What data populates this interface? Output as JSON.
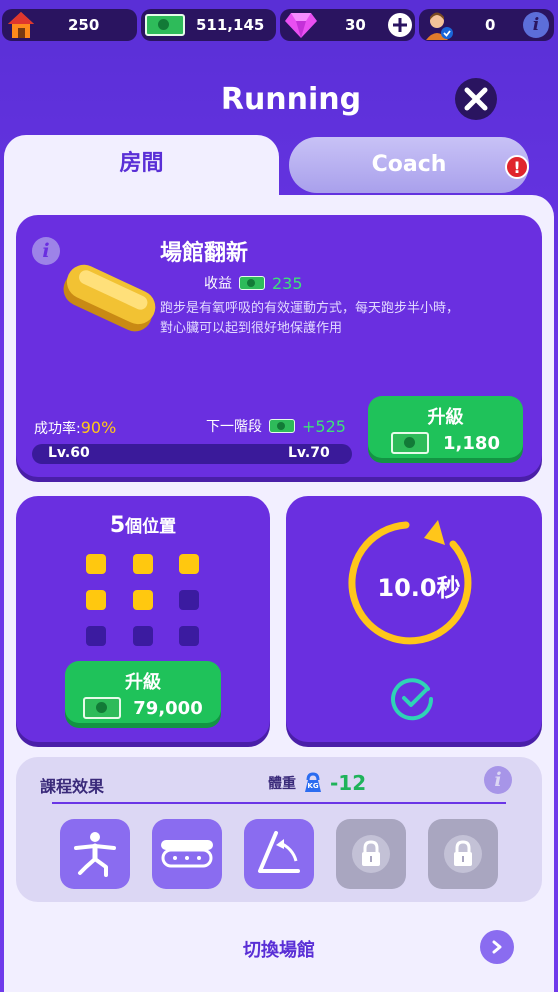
{
  "status_bar": {
    "homes": "250",
    "cash": "511,145",
    "gems": "30",
    "members": "0"
  },
  "header": {
    "title": "Running"
  },
  "tabs": {
    "room": "房間",
    "coach": "Coach",
    "coach_alert": "!"
  },
  "facility": {
    "name": "場館翻新",
    "income_label": "收益",
    "income_value": "235",
    "description_line1": "跑步是有氧呼吸的有效運動方式，每天跑步半小時，",
    "description_line2": "對心臟可以起到很好地保護作用",
    "success_label": "成功率:",
    "success_value": "90%",
    "next_stage_label": "下一階段",
    "next_stage_value": "+525",
    "level_current": "Lv.60",
    "level_next": "Lv.70",
    "upgrade_label": "升級",
    "upgrade_cost": "1,180"
  },
  "positions": {
    "count": "5",
    "label": "個位置",
    "filled": 5,
    "total": 9,
    "upgrade_label": "升級",
    "upgrade_cost": "79,000"
  },
  "timer": {
    "value": "10.0秒"
  },
  "effects": {
    "title": "課程效果",
    "weight_label": "體重",
    "weight_icon_text": "KG",
    "weight_value": "-12",
    "tiles": [
      {
        "icon": "stretch-figure-icon",
        "locked": false
      },
      {
        "icon": "treadmill-icon",
        "locked": false
      },
      {
        "icon": "angle-icon",
        "locked": false
      },
      {
        "icon": "lock-icon",
        "locked": true
      },
      {
        "icon": "lock-icon",
        "locked": true
      }
    ]
  },
  "footer": {
    "switch_label": "切換場館"
  },
  "colors": {
    "background": "#6a35e6",
    "card": "#6a2fe0",
    "sheet": "#f2efff",
    "accent_green": "#1fc25a",
    "timer_yellow": "#ffc61a",
    "check_teal": "#2fd3b6"
  }
}
